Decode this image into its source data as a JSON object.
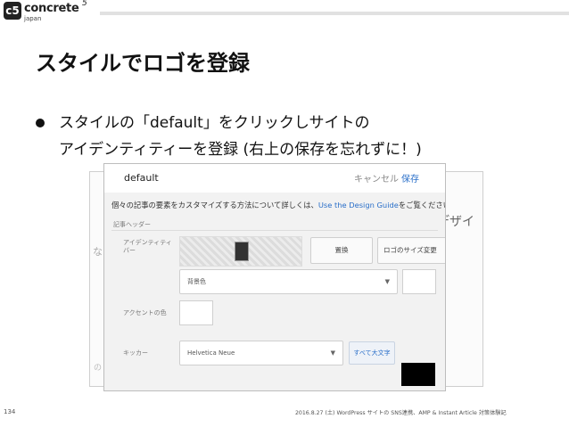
{
  "header": {
    "logo_text": "concrete",
    "logo_five": "5",
    "logo_sub": "japan",
    "logo_mark": "c5"
  },
  "slide": {
    "title": "スタイルでロゴを登録",
    "bullet_line1": "スタイルの「default」をクリックしサイトの",
    "bullet_line2": "アイデンティティーを登録 (右上の保存を忘れずに！)"
  },
  "background_page": {
    "text1": "のデザイ",
    "text2": "o",
    "text3": "な",
    "text4": "の"
  },
  "style_panel": {
    "title": "default",
    "cancel_label": "キャンセル",
    "save_label": "保存",
    "description_prefix": "個々の記事の要素をカスタマイズする方法について詳しくは、",
    "description_link": "Use the Design Guide",
    "description_suffix": "をご覧ください。",
    "section_header": "記事ヘッダー",
    "identity_label": "アイデンティティバー",
    "replace_label": "置換",
    "logo_size_label": "ロゴのサイズ変更",
    "background_color_label": "背景色",
    "accent_color_label": "アクセントの色",
    "kicker_label": "キッカー",
    "font_value": "Helvetica Neue",
    "all_caps_label": "すべて大文字"
  },
  "footer": {
    "page_number": "134",
    "text": "2016.8.27 (土) WordPress サイトの SNS連携、AMP & Instant Article 対策体験記"
  }
}
